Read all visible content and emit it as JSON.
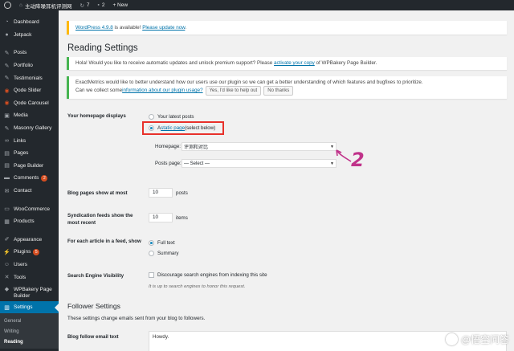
{
  "adminbar": {
    "site_title": "主动降噪耳机评测网",
    "updates_count": "7",
    "comments_count": "2",
    "new_label": "+ New"
  },
  "sidebar": {
    "items": [
      {
        "label": "Dashboard",
        "icon": "dashboard-icon"
      },
      {
        "label": "Jetpack",
        "icon": "jetpack-icon"
      },
      {
        "label": "Posts",
        "icon": "pin-icon"
      },
      {
        "label": "Portfolio",
        "icon": "portfolio-icon"
      },
      {
        "label": "Testimonials",
        "icon": "quote-icon"
      },
      {
        "label": "Qode Slider",
        "icon": "qode-icon"
      },
      {
        "label": "Qode Carousel",
        "icon": "qode-icon"
      },
      {
        "label": "Media",
        "icon": "media-icon"
      },
      {
        "label": "Masonry Gallery",
        "icon": "gallery-icon"
      },
      {
        "label": "Links",
        "icon": "link-icon"
      },
      {
        "label": "Pages",
        "icon": "page-icon"
      },
      {
        "label": "Page Builder",
        "icon": "builder-icon"
      },
      {
        "label": "Comments",
        "icon": "comment-icon",
        "badge": "2"
      },
      {
        "label": "Contact",
        "icon": "mail-icon"
      },
      {
        "label": "WooCommerce",
        "icon": "woo-icon"
      },
      {
        "label": "Products",
        "icon": "product-icon"
      },
      {
        "label": "Appearance",
        "icon": "brush-icon"
      },
      {
        "label": "Plugins",
        "icon": "plugin-icon",
        "badge": "5"
      },
      {
        "label": "Users",
        "icon": "user-icon"
      },
      {
        "label": "Tools",
        "icon": "wrench-icon"
      },
      {
        "label": "WPBakery Page Builder",
        "icon": "wpbakery-icon"
      },
      {
        "label": "Settings",
        "icon": "settings-icon"
      }
    ],
    "submenu": [
      "General",
      "Writing",
      "Reading"
    ]
  },
  "notices": {
    "update_pre": "WordPress 4.9.8",
    "update_mid": " is available! ",
    "update_link": "Please update now",
    "update_post": ".",
    "vc_pre": "Hola! Would you like to receive automatic updates and unlock premium support? Please ",
    "vc_link": "activate your copy",
    "vc_post": " of WPBakery Page Builder.",
    "em_line1": "ExactMetrics would like to better understand how our users use our plugin so we can get a better understanding of which features and bugfixes to prioritize.",
    "em_line2_pre": "Can we collect some ",
    "em_link": "information about our plugin usage?",
    "em_yes": "Yes, I'd like to help out",
    "em_no": "No thanks"
  },
  "page": {
    "title": "Reading Settings"
  },
  "homepage": {
    "label": "Your homepage displays",
    "opt_latest": "Your latest posts",
    "opt_static_pre": "A ",
    "opt_static_link": "static page",
    "opt_static_post": " (select below)",
    "selected": "static",
    "homepage_label": "Homepage:",
    "homepage_value": "评测和对比",
    "postspage_label": "Posts page:",
    "postspage_value": "— Select —"
  },
  "blog_pages": {
    "label": "Blog pages show at most",
    "value": "10",
    "unit": "posts"
  },
  "syndication": {
    "label": "Syndication feeds show the most recent",
    "value": "10",
    "unit": "items"
  },
  "feed_show": {
    "label": "For each article in a feed, show",
    "opt_full": "Full text",
    "opt_summary": "Summary",
    "selected": "full"
  },
  "visibility": {
    "label": "Search Engine Visibility",
    "checkbox_label": "Discourage search engines from indexing this site",
    "desc": "It is up to search engines to honor this request."
  },
  "follower": {
    "title": "Follower Settings",
    "desc": "These settings change emails sent from your blog to followers.",
    "email_label": "Blog follow email text",
    "email_value": "Howdy."
  },
  "annotation": {
    "number": "2",
    "color": "#e8312b",
    "arrow_color": "#c0338a"
  },
  "watermark": {
    "text": "@悟空问答"
  }
}
